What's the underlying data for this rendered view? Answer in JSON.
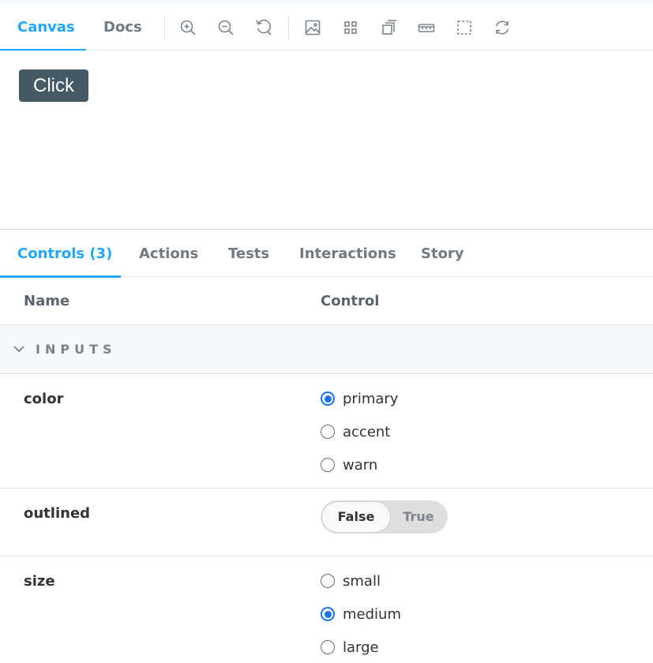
{
  "preview_tabs": [
    {
      "label": "Canvas",
      "active": true
    },
    {
      "label": "Docs",
      "active": false
    }
  ],
  "toolbar_tools": [
    "zoom-in-icon",
    "zoom-out-icon",
    "reset-zoom-icon",
    "background-icon",
    "grid-icon",
    "viewport-icon",
    "measure-icon",
    "outline-icon",
    "remount-icon"
  ],
  "story": {
    "button_label": "Click",
    "button_color": "#455a64"
  },
  "addon_tabs": [
    {
      "label": "Controls (3)",
      "active": true
    },
    {
      "label": "Actions",
      "active": false
    },
    {
      "label": "Tests",
      "active": false
    },
    {
      "label": "Interactions",
      "active": false
    },
    {
      "label": "Story",
      "active": false
    }
  ],
  "table": {
    "headers": {
      "name": "Name",
      "control": "Control"
    },
    "section": "INPUTS",
    "rows": [
      {
        "name": "color",
        "type": "radio",
        "options": [
          "primary",
          "accent",
          "warn"
        ],
        "selected": "primary"
      },
      {
        "name": "outlined",
        "type": "boolean",
        "options": [
          "False",
          "True"
        ],
        "selected": "False"
      },
      {
        "name": "size",
        "type": "radio",
        "options": [
          "small",
          "medium",
          "large"
        ],
        "selected": "medium"
      }
    ]
  },
  "colors": {
    "accent": "#1ea7fd",
    "radio_selected": "#1a73e8"
  }
}
